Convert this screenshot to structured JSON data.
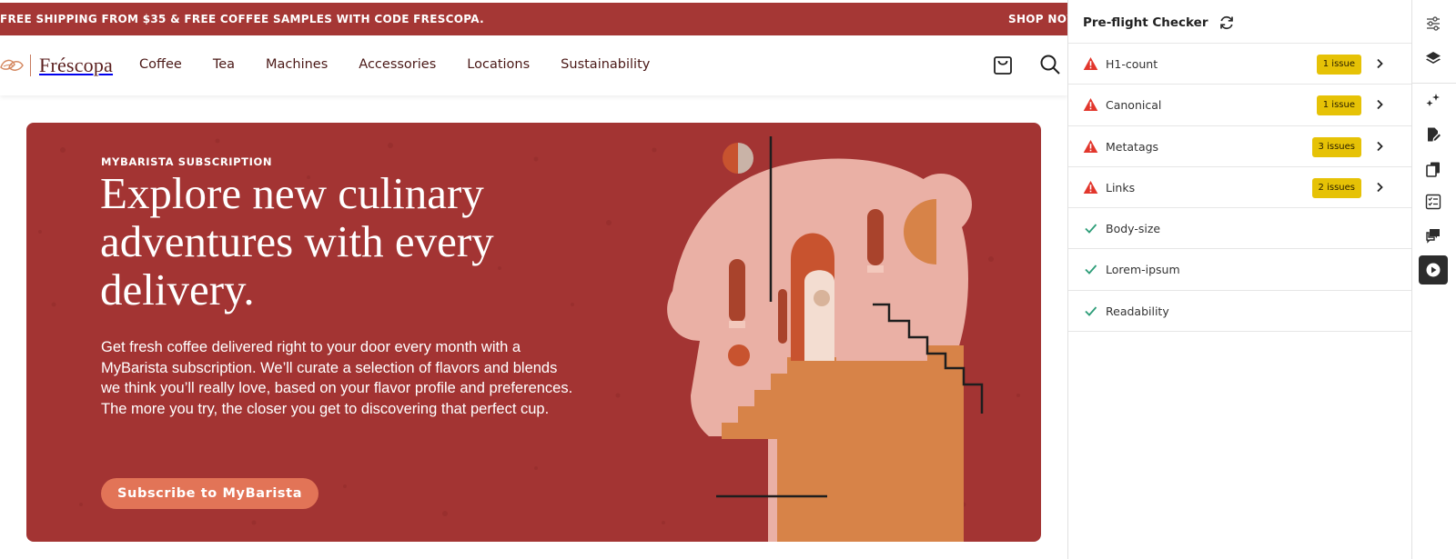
{
  "promo": {
    "text": "FREE SHIPPING FROM $35 & FREE COFFEE SAMPLES WITH CODE FRESCOPA.",
    "cta": "SHOP NOW"
  },
  "brand": {
    "name": "Fréscopa"
  },
  "nav": {
    "items": [
      "Coffee",
      "Tea",
      "Machines",
      "Accessories",
      "Locations",
      "Sustainability"
    ]
  },
  "hero": {
    "eyebrow": "MYBARISTA SUBSCRIPTION",
    "title": "Explore new culinary adventures with every delivery.",
    "description": "Get fresh coffee delivered right to your door every month with a MyBarista subscription. We’ll curate a selection of flavors and blends we think you’ll really love, based on your flavor profile and preferences. The more you try, the closer you get to discovering that perfect cup.",
    "cta": "Subscribe to MyBarista"
  },
  "checker": {
    "title": "Pre-flight Checker",
    "checks": [
      {
        "label": "H1-count",
        "status": "error",
        "badge": "1 issue"
      },
      {
        "label": "Canonical",
        "status": "error",
        "badge": "1 issue"
      },
      {
        "label": "Metatags",
        "status": "error",
        "badge": "3 issues"
      },
      {
        "label": "Links",
        "status": "error",
        "badge": "2 issues"
      },
      {
        "label": "Body-size",
        "status": "pass"
      },
      {
        "label": "Lorem-ipsum",
        "status": "pass"
      },
      {
        "label": "Readability",
        "status": "pass"
      }
    ]
  },
  "rail": {
    "icons": [
      "properties-icon",
      "layers-icon",
      "assets-icon",
      "edit-page-icon",
      "copy-icon",
      "checklist-icon",
      "comments-icon",
      "play-icon"
    ],
    "active": "play-icon"
  },
  "colors": {
    "promo_bg": "#a53735",
    "hero_bg": "#a33433",
    "cta_bg": "#e27457",
    "badge_bg": "#e6c206",
    "error": "#e2362c",
    "pass": "#2d9d78"
  }
}
